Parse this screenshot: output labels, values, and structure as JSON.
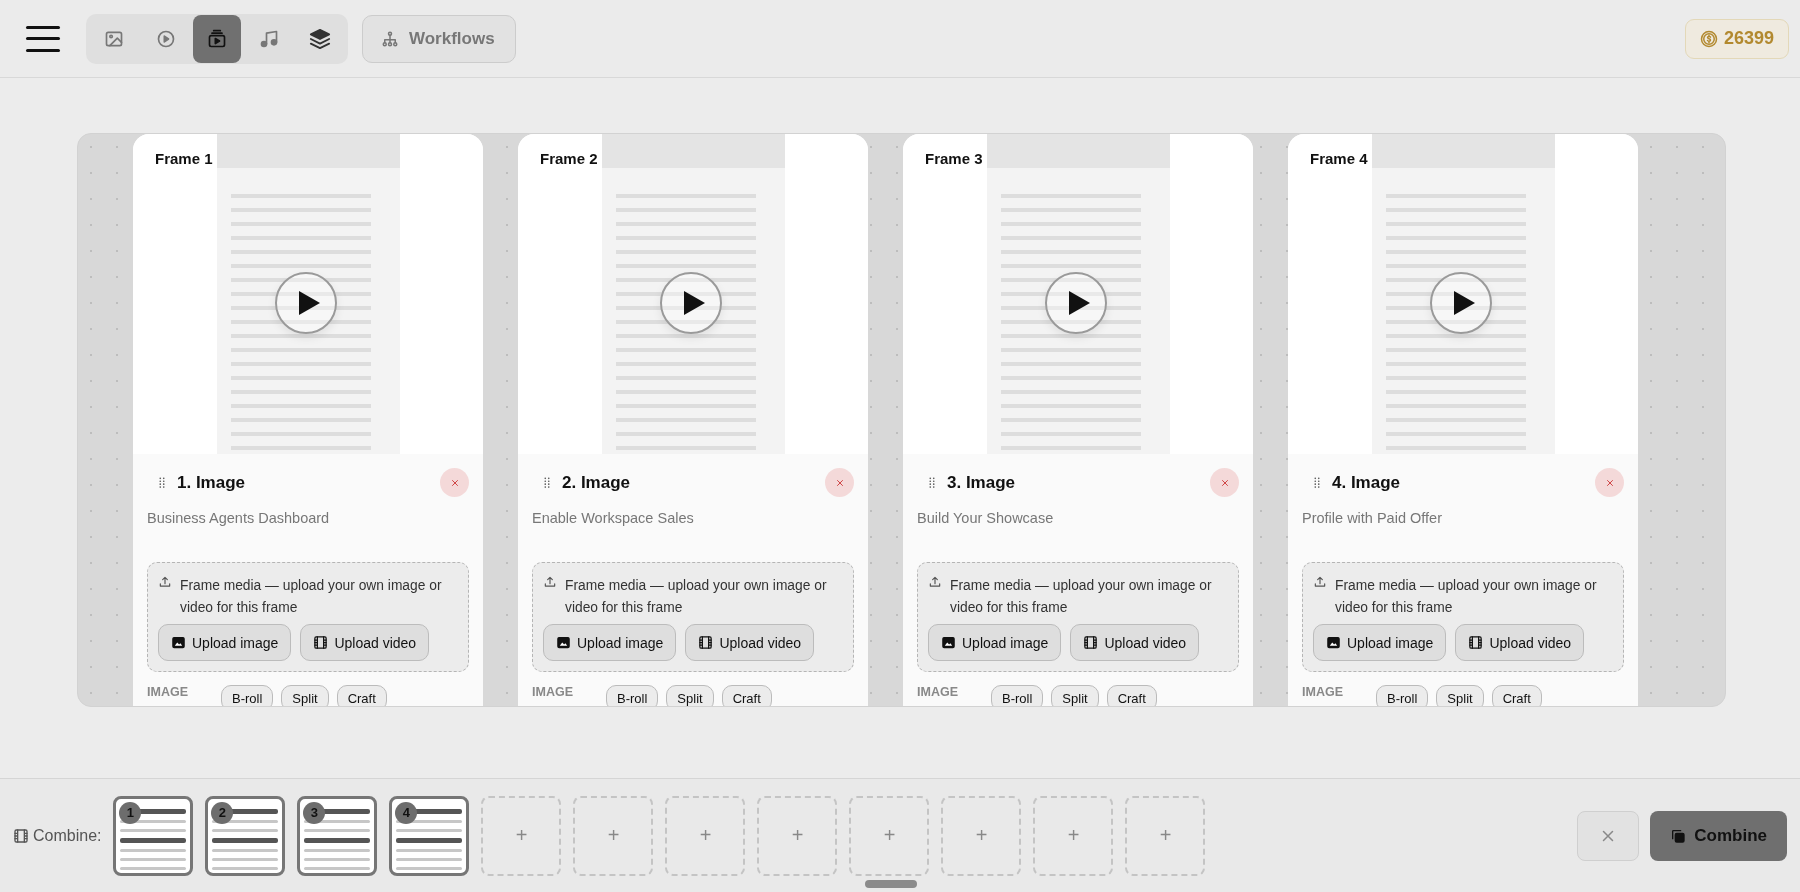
{
  "top_bar": {
    "media_tabs": [
      {
        "kind": "image",
        "selected": false
      },
      {
        "kind": "video",
        "selected": false
      },
      {
        "kind": "slideshow",
        "selected": true
      },
      {
        "kind": "music",
        "selected": false
      },
      {
        "kind": "layers",
        "selected": false
      }
    ],
    "workflows": "Workflows",
    "coins": "26399"
  },
  "frames": [
    {
      "label": "Frame 1",
      "title": "1. Image",
      "subtitle": "Business Agents Dashboard",
      "media_hint": "Frame media — upload your own image or video for this frame",
      "upload_image": "Upload image",
      "upload_video": "Upload video",
      "section": "IMAGE",
      "chips": [
        "B-roll",
        "Split",
        "Craft"
      ]
    },
    {
      "label": "Frame 2",
      "title": "2. Image",
      "subtitle": "Enable Workspace Sales",
      "media_hint": "Frame media — upload your own image or video for this frame",
      "upload_image": "Upload image",
      "upload_video": "Upload video",
      "section": "IMAGE",
      "chips": [
        "B-roll",
        "Split",
        "Craft"
      ]
    },
    {
      "label": "Frame 3",
      "title": "3. Image",
      "subtitle": "Build Your Showcase",
      "media_hint": "Frame media — upload your own image or video for this frame",
      "upload_image": "Upload image",
      "upload_video": "Upload video",
      "section": "IMAGE",
      "chips": [
        "B-roll",
        "Split",
        "Craft"
      ]
    },
    {
      "label": "Frame 4",
      "title": "4. Image",
      "subtitle": "Profile with Paid Offer",
      "media_hint": "Frame media — upload your own image or video for this frame",
      "upload_image": "Upload image",
      "upload_video": "Upload video",
      "section": "IMAGE",
      "chips": [
        "B-roll",
        "Split",
        "Craft"
      ]
    }
  ],
  "combine_bar": {
    "label": "Combine:",
    "slots": [
      {
        "filled": true,
        "number": "1"
      },
      {
        "filled": true,
        "number": "2"
      },
      {
        "filled": true,
        "number": "3"
      },
      {
        "filled": true,
        "number": "4"
      },
      {
        "filled": false,
        "plus": "+"
      },
      {
        "filled": false,
        "plus": "+"
      },
      {
        "filled": false,
        "plus": "+"
      },
      {
        "filled": false,
        "plus": "+"
      },
      {
        "filled": false,
        "plus": "+"
      },
      {
        "filled": false,
        "plus": "+"
      },
      {
        "filled": false,
        "plus": "+"
      },
      {
        "filled": false,
        "plus": "+"
      }
    ],
    "combine": "Combine"
  }
}
